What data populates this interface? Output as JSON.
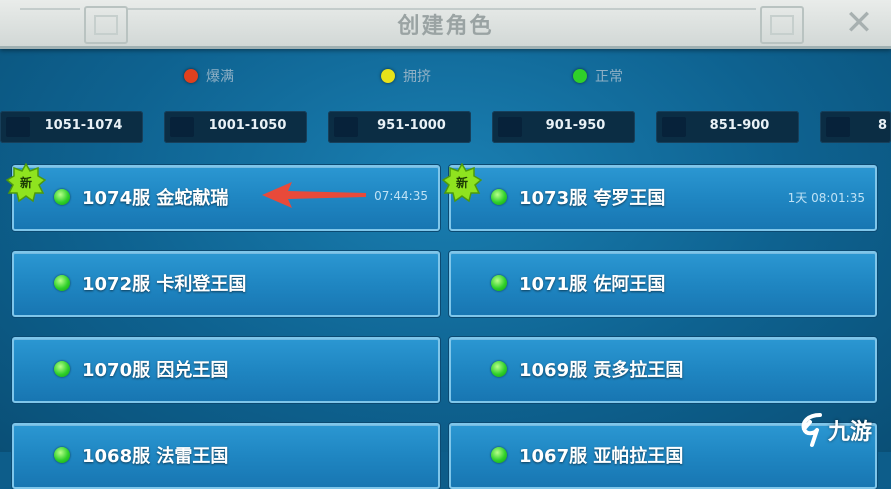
{
  "header": {
    "title": "创建角色",
    "close_icon": "close-icon"
  },
  "legend": [
    {
      "label": "爆满",
      "color": "#e0401e"
    },
    {
      "label": "拥挤",
      "color": "#e8e21a"
    },
    {
      "label": "正常",
      "color": "#2fd02a"
    }
  ],
  "range_tabs": [
    "1051-1074",
    "1001-1050",
    "951-1000",
    "901-950",
    "851-900",
    "8"
  ],
  "servers": [
    {
      "name": "1074服 金蛇献瑞",
      "time": "07:44:35",
      "is_new": true,
      "status": "normal"
    },
    {
      "name": "1073服 夸罗王国",
      "time": "1天 08:01:35",
      "is_new": true,
      "status": "normal"
    },
    {
      "name": "1072服 卡利登王国",
      "time": "",
      "is_new": false,
      "status": "normal"
    },
    {
      "name": "1071服 佐阿王国",
      "time": "",
      "is_new": false,
      "status": "normal"
    },
    {
      "name": "1070服 因兑王国",
      "time": "",
      "is_new": false,
      "status": "normal"
    },
    {
      "name": "1069服 贡多拉王国",
      "time": "",
      "is_new": false,
      "status": "normal"
    },
    {
      "name": "1068服 法雷王国",
      "time": "",
      "is_new": false,
      "status": "normal"
    },
    {
      "name": "1067服 亚帕拉王国",
      "time": "",
      "is_new": false,
      "status": "normal"
    }
  ],
  "badge": {
    "new_label": "新"
  },
  "watermark": {
    "text": "九游"
  }
}
